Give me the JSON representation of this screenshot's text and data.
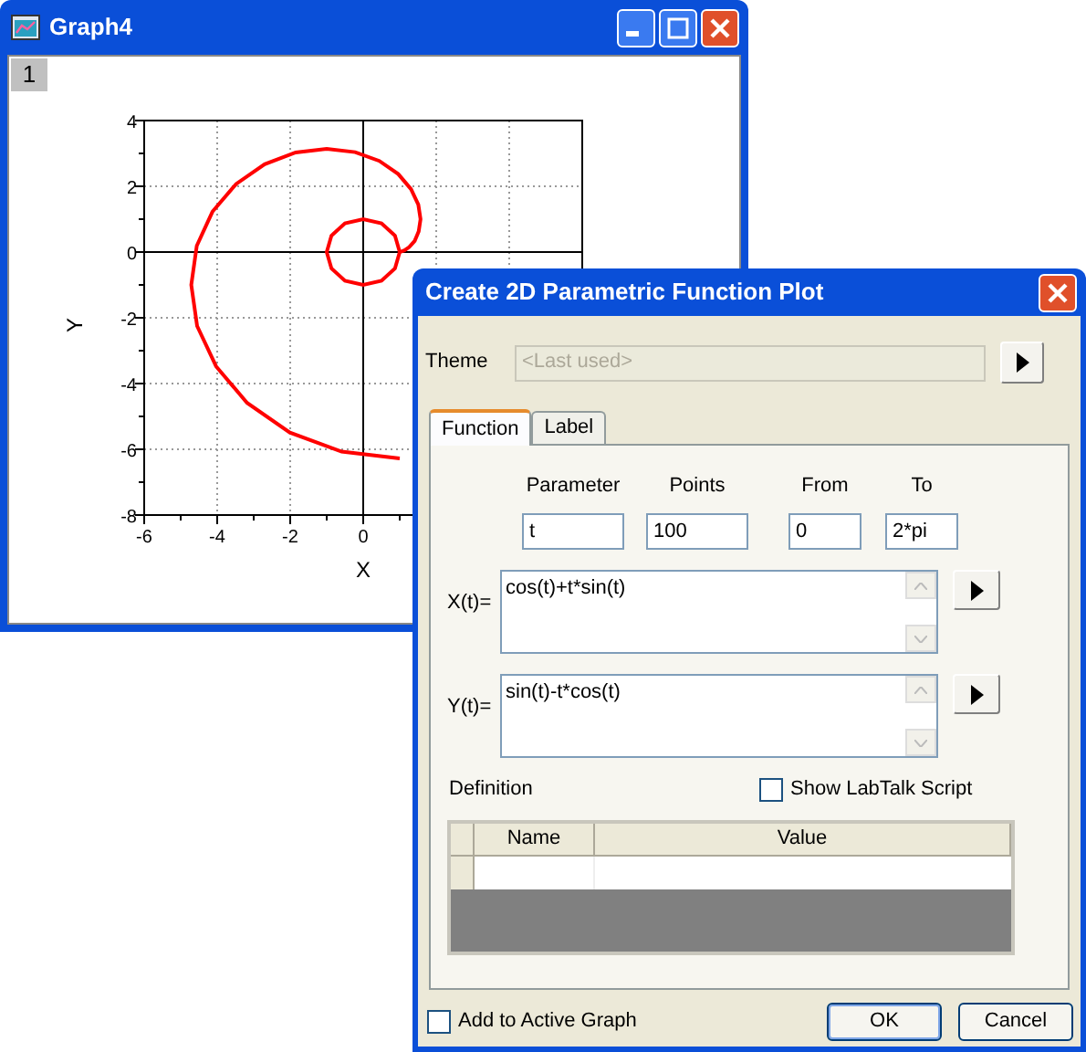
{
  "graph_window": {
    "title": "Graph4",
    "page_tab": "1",
    "chart_data": {
      "type": "line",
      "xlabel": "X",
      "ylabel": "Y",
      "xlim": [
        -6,
        6
      ],
      "ylim": [
        -8,
        4
      ],
      "xticks": [
        -6,
        -4,
        -2,
        0
      ],
      "yticks": [
        -8,
        -6,
        -4,
        -2,
        0,
        2,
        4
      ],
      "grid": true,
      "x": [
        1,
        0.87,
        0.5,
        0,
        -0.5,
        -0.87,
        -1,
        -0.87,
        -0.5,
        0,
        0.5,
        0.87,
        1,
        1.03,
        1.13,
        1.26,
        1.41,
        1.52,
        1.57,
        1.51,
        1.31,
        0.96,
        0.44,
        -0.22,
        -1,
        -1.85,
        -2.7,
        -3.48,
        -4.13,
        -4.56,
        -4.71,
        -4.55,
        -4.03,
        -3.18,
        -2.01,
        -0.59,
        1
      ],
      "series": [
        {
          "color": "#ff0000",
          "values": [
            0,
            0.5,
            0.87,
            1,
            0.87,
            0.5,
            0,
            -0.5,
            -0.87,
            -1,
            -0.87,
            -0.5,
            0,
            0.01,
            0.05,
            0.15,
            0.34,
            0.63,
            1,
            1.44,
            1.91,
            2.37,
            2.77,
            3.04,
            3.14,
            3.03,
            2.67,
            2.07,
            1.23,
            0.19,
            -1,
            -2.25,
            -3.48,
            -4.59,
            -5.49,
            -6.07,
            -6.28
          ]
        }
      ]
    }
  },
  "dialog": {
    "title": "Create 2D Parametric Function Plot",
    "theme": {
      "label": "Theme",
      "value": "<Last used>",
      "disabled": true
    },
    "tabs": [
      {
        "label": "Function",
        "selected": true
      },
      {
        "label": "Label",
        "selected": false
      }
    ],
    "parameters": [
      {
        "heading": "Parameter",
        "value": "t"
      },
      {
        "heading": "Points",
        "value": "100"
      },
      {
        "heading": "From",
        "value": "0"
      },
      {
        "heading": "To",
        "value": "2*pi"
      }
    ],
    "functions": [
      {
        "label": "X(t)=",
        "value": "cos(t)+t*sin(t)"
      },
      {
        "label": "Y(t)=",
        "value": "sin(t)-t*cos(t)"
      }
    ],
    "definition": {
      "label": "Definition"
    },
    "show_script": {
      "label": "Show LabTalk Script",
      "checked": false
    },
    "table": {
      "columns": [
        "Name",
        "Value"
      ]
    },
    "add_to_active_graph": {
      "label": "Add to Active Graph",
      "checked": false
    },
    "buttons": [
      "OK",
      "Cancel"
    ]
  }
}
